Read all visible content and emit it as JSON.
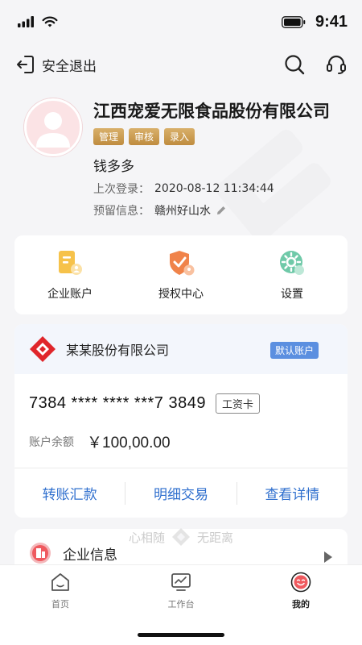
{
  "status_bar": {
    "time": "9:41"
  },
  "header": {
    "logout_label": "安全退出"
  },
  "profile": {
    "company": "江西宠爱无限食品股份有限公司",
    "roles": [
      "管理",
      "审核",
      "录入"
    ],
    "username": "钱多多",
    "last_login_label": "上次登录：",
    "last_login_value": "2020-08-12 11:34:44",
    "reserved_label": "预留信息：",
    "reserved_value": "赣州好山水"
  },
  "quick_actions": [
    {
      "label": "企业账户",
      "icon": "enterprise-account-icon"
    },
    {
      "label": "授权中心",
      "icon": "authorization-icon"
    },
    {
      "label": "设置",
      "icon": "settings-icon"
    }
  ],
  "account": {
    "bank_name": "某某股份有限公司",
    "default_badge": "默认账户",
    "number": "7384 **** **** ***7 3849",
    "card_type": "工资卡",
    "balance_label": "账户余额",
    "balance_value": "￥100,00.00",
    "actions": [
      "转账汇款",
      "明细交易",
      "查看详情"
    ]
  },
  "slogan": {
    "left": "心相随",
    "right": "无距离"
  },
  "menu": {
    "item_label": "企业信息"
  },
  "tabbar": {
    "tabs": [
      {
        "label": "首页",
        "icon": "home-icon"
      },
      {
        "label": "工作台",
        "icon": "workbench-icon"
      },
      {
        "label": "我的",
        "icon": "mine-icon"
      }
    ],
    "active_index": 2
  },
  "colors": {
    "accent": "#2f6fce",
    "gold": "#c8964a",
    "default_badge": "#5b8fe0"
  }
}
